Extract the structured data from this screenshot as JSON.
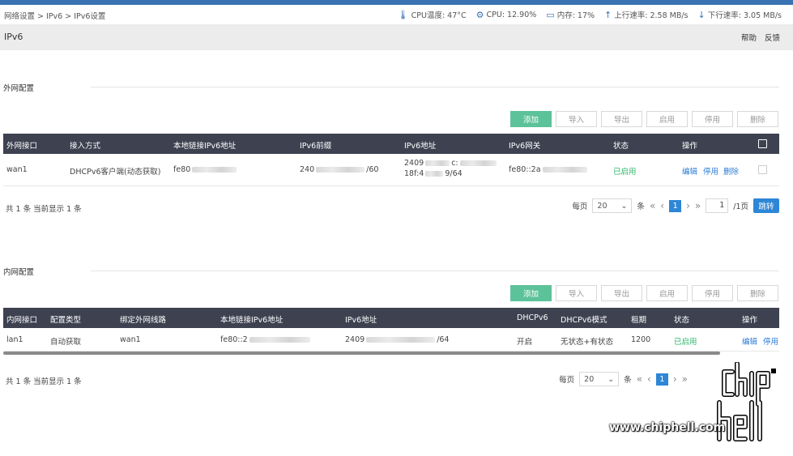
{
  "breadcrumb": "网络设置 > IPv6 > IPv6设置",
  "stats": [
    {
      "icon": "thermometer-icon",
      "glyph": "🌡",
      "text": "CPU温度: 47°C"
    },
    {
      "icon": "cpu-icon",
      "glyph": "⚙",
      "text": "CPU: 12.90%"
    },
    {
      "icon": "monitor-icon",
      "glyph": "▭",
      "text": "内存: 17%"
    },
    {
      "icon": "upload-arrow-icon",
      "glyph": "↑",
      "text": "上行速率: 2.58 MB/s"
    },
    {
      "icon": "download-arrow-icon",
      "glyph": "↓",
      "text": "下行速率: 3.05 MB/s"
    }
  ],
  "page": {
    "title": "IPv6",
    "help": "帮助",
    "feedback": "反馈"
  },
  "wan": {
    "section_title": "外网配置",
    "buttons": {
      "add": "添加",
      "import": "导入",
      "export": "导出",
      "enable": "启用",
      "disable": "停用",
      "delete": "删除"
    },
    "headers": [
      "外网接口",
      "接入方式",
      "本地链接IPv6地址",
      "IPv6前缀",
      "IPv6地址",
      "IPv6网关",
      "状态",
      "操作"
    ],
    "row": {
      "iface": "wan1",
      "mode": "DHCPv6客户端(动态获取)",
      "local_addr": "fe80",
      "prefix_start": "240",
      "prefix_end": "/60",
      "addr_line1": "2409",
      "addr_line1_mid": "c:",
      "addr_line2_start": "18f:4",
      "addr_line2_end": "9/64",
      "gateway": "fe80::2a",
      "status": "已启用",
      "actions": {
        "edit": "编辑",
        "disable": "停用",
        "delete": "删除"
      }
    },
    "summary": "共 1 条 当前显示 1 条",
    "pager": {
      "per_page_label": "每页",
      "per_page": "20",
      "unit": "条",
      "current": "1",
      "page_input": "1",
      "total": "/1页",
      "jump": "跳转"
    }
  },
  "lan": {
    "section_title": "内网配置",
    "buttons": {
      "add": "添加",
      "import": "导入",
      "export": "导出",
      "enable": "启用",
      "disable": "停用",
      "delete": "删除"
    },
    "headers": [
      "内网接口",
      "配置类型",
      "绑定外网线路",
      "本地链接IPv6地址",
      "IPv6地址",
      "DHCPv6",
      "DHCPv6模式",
      "租期",
      "状态",
      "操作"
    ],
    "row": {
      "iface": "lan1",
      "type": "自动获取",
      "bind": "wan1",
      "local_addr": "fe80::2",
      "addr_start": "2409",
      "addr_end": "/64",
      "dhcpv6": "开启",
      "dhcpv6_mode": "无状态+有状态",
      "lease": "1200",
      "status": "已启用",
      "actions": {
        "edit": "编辑",
        "disable": "停用"
      }
    },
    "summary": "共 1 条 当前显示 1 条",
    "pager": {
      "per_page_label": "每页",
      "per_page": "20",
      "unit": "条",
      "current": "1"
    }
  },
  "watermark": {
    "site": "www.chiphell.com",
    "logo": "chip hell"
  }
}
